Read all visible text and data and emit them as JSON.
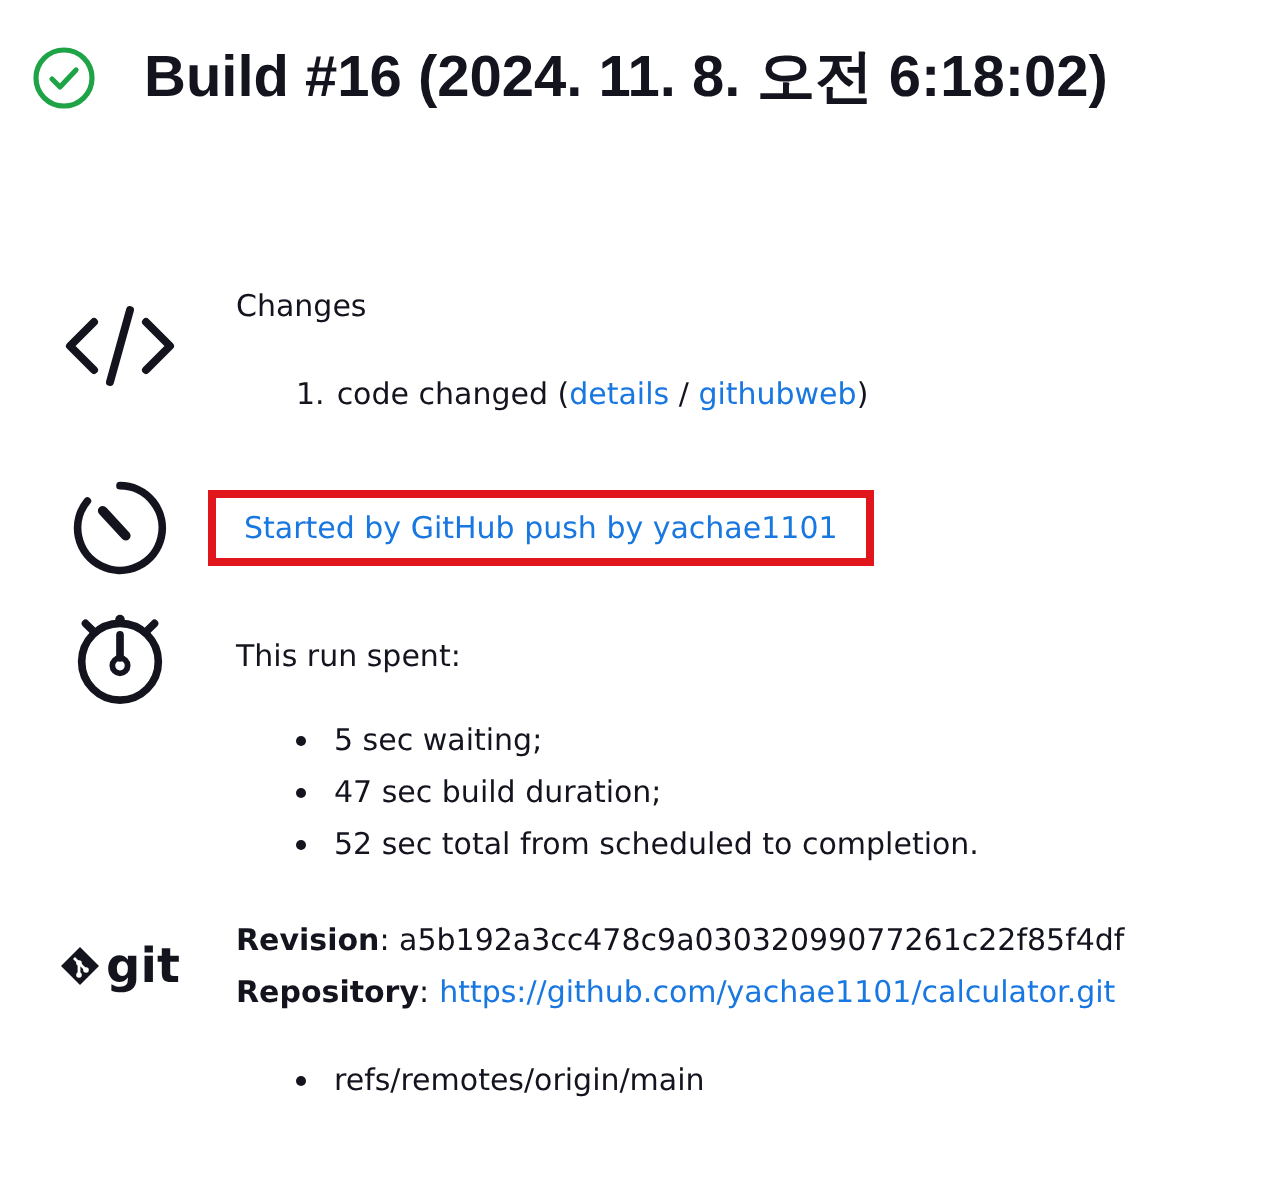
{
  "title": {
    "succeeded": true,
    "text": "Build #16 (2024. 11. 8. 오전 6:18:02)"
  },
  "changes": {
    "heading": "Changes",
    "items": [
      {
        "number": "1.",
        "text": "code changed (",
        "link_1": "details",
        "separator": " / ",
        "link_2": "githubweb",
        "close": ")"
      }
    ]
  },
  "cause": {
    "text": "Started by GitHub push by yachae1101",
    "highlighted": true
  },
  "timing": {
    "heading": "This run spent:",
    "items": [
      "5 sec waiting;",
      "47 sec build duration;",
      "52 sec total from scheduled to completion."
    ]
  },
  "scm": {
    "logo_text": "git",
    "revision": "**Revision**: a5b192a3cc478c9a03032099077261c22f85f4df",
    "repository_label": "**Repository**:",
    "repository": "https://github.com/yachae1101/calculator.git",
    "branches": [
      "refs/remotes/origin/main"
    ]
  }
}
